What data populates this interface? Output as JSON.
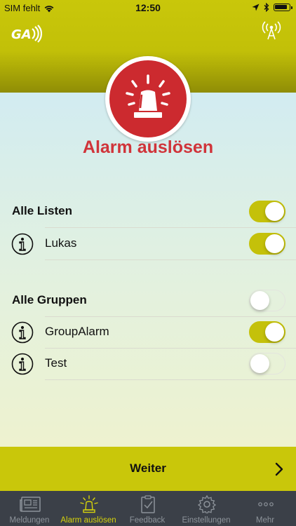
{
  "status_bar": {
    "carrier": "SIM fehlt",
    "time": "12:50"
  },
  "page": {
    "title": "Alarm auslösen"
  },
  "lists_section": {
    "header": {
      "label": "Alle Listen",
      "toggle_on": true
    },
    "items": [
      {
        "label": "Lukas",
        "toggle_on": true
      }
    ]
  },
  "groups_section": {
    "header": {
      "label": "Alle Gruppen",
      "toggle_on": false
    },
    "items": [
      {
        "label": "GroupAlarm",
        "toggle_on": true
      },
      {
        "label": "Test",
        "toggle_on": false
      }
    ]
  },
  "weiter": {
    "label": "Weiter"
  },
  "tabs": [
    {
      "label": "Meldungen",
      "icon": "newspaper-icon",
      "active": false
    },
    {
      "label": "Alarm auslösen",
      "icon": "siren-icon",
      "active": true
    },
    {
      "label": "Feedback",
      "icon": "clipboard-check-icon",
      "active": false
    },
    {
      "label": "Einstellungen",
      "icon": "gear-icon",
      "active": false
    },
    {
      "label": "Mehr",
      "icon": "more-dots-icon",
      "active": false
    }
  ],
  "colors": {
    "accent": "#c9c70a",
    "alarm_red": "#cc2a2f",
    "title_red": "#d0343a",
    "tabbar_bg": "#3b4048"
  }
}
